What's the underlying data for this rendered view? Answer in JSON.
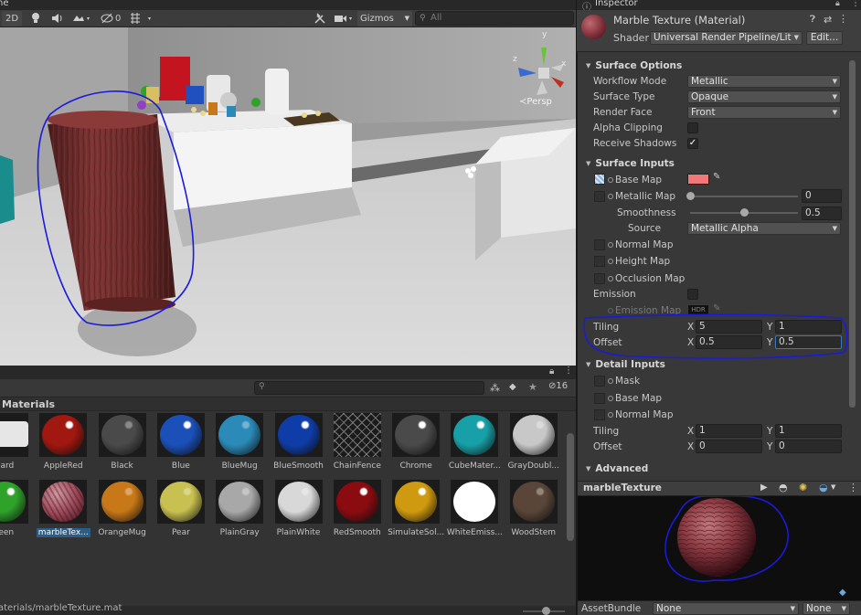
{
  "scene": {
    "tab_title": "ne",
    "toolbar": {
      "mode_2d": "2D",
      "effects_count": "0",
      "gizmos_label": "Gizmos",
      "search_placeholder": "All"
    },
    "persp_label": "Persp",
    "axis_labels": {
      "y": "y",
      "z": "z",
      "x": "x"
    }
  },
  "project": {
    "folder_title": "Materials",
    "item_count": "16",
    "materials": [
      {
        "name": "dard",
        "color": "#e6e6e6",
        "style": "flat"
      },
      {
        "name": "AppleRed",
        "color": "#a01810",
        "style": "glossy"
      },
      {
        "name": "Black",
        "color": "#4a4a4a",
        "style": "matte"
      },
      {
        "name": "Blue",
        "color": "#1b50b8",
        "style": "glossy"
      },
      {
        "name": "BlueMug",
        "color": "#2b8ab8",
        "style": "matte"
      },
      {
        "name": "BlueSmooth",
        "color": "#0f3da8",
        "style": "glossy"
      },
      {
        "name": "ChainFence",
        "color": "#1a1a1a",
        "style": "fence"
      },
      {
        "name": "Chrome",
        "color": "#4a4a4a",
        "style": "chrome"
      },
      {
        "name": "CubeMater...",
        "color": "#18a0a8",
        "style": "glossy"
      },
      {
        "name": "GrayDoubl...",
        "color": "#c8c8c8",
        "style": "matte"
      },
      {
        "name": "reen",
        "color": "#2fa22a",
        "style": "glossy"
      },
      {
        "name": "marbleTex...",
        "color": "#9c4a5a",
        "style": "marble",
        "selected": true
      },
      {
        "name": "OrangeMug",
        "color": "#c87818",
        "style": "matte"
      },
      {
        "name": "Pear",
        "color": "#c8c050",
        "style": "matte"
      },
      {
        "name": "PlainGray",
        "color": "#a8a8a8",
        "style": "matte"
      },
      {
        "name": "PlainWhite",
        "color": "#d8d8d8",
        "style": "matte"
      },
      {
        "name": "RedSmooth",
        "color": "#8a0c10",
        "style": "glossy"
      },
      {
        "name": "SimulateSol...",
        "color": "#d09a10",
        "style": "glossy"
      },
      {
        "name": "WhiteEmiss...",
        "color": "#ffffff",
        "style": "emissive"
      },
      {
        "name": "WoodStem",
        "color": "#5a4638",
        "style": "matte"
      }
    ],
    "path": "aterials/marbleTexture.mat"
  },
  "inspector": {
    "tab_title": "Inspector",
    "material_name": "Marble Texture (Material)",
    "shader_label": "Shader",
    "shader_value": "Universal Render Pipeline/Lit",
    "edit_button": "Edit...",
    "surface_options": {
      "title": "Surface Options",
      "workflow_label": "Workflow Mode",
      "workflow_value": "Metallic",
      "surface_type_label": "Surface Type",
      "surface_type_value": "Opaque",
      "render_face_label": "Render Face",
      "render_face_value": "Front",
      "alpha_clipping_label": "Alpha Clipping",
      "receive_shadows_label": "Receive Shadows"
    },
    "surface_inputs": {
      "title": "Surface Inputs",
      "base_map_label": "Base Map",
      "base_color": "#f07878",
      "metallic_map_label": "Metallic Map",
      "metallic_value": "0",
      "metallic_level": 0,
      "smoothness_label": "Smoothness",
      "smoothness_value": "0.5",
      "smoothness_level": 0.5,
      "source_label": "Source",
      "source_value": "Metallic Alpha",
      "normal_map_label": "Normal Map",
      "height_map_label": "Height Map",
      "occlusion_map_label": "Occlusion Map",
      "emission_label": "Emission",
      "emission_map_label": "Emission Map",
      "hdr_badge": "HDR",
      "tiling_label": "Tiling",
      "tiling_x": "5",
      "tiling_y": "1",
      "offset_label": "Offset",
      "offset_x": "0.5",
      "offset_y": "0.5"
    },
    "detail_inputs": {
      "title": "Detail Inputs",
      "mask_label": "Mask",
      "base_map_label": "Base Map",
      "normal_map_label": "Normal Map",
      "tiling_label": "Tiling",
      "tiling_x": "1",
      "tiling_y": "1",
      "offset_label": "Offset",
      "offset_x": "0",
      "offset_y": "0"
    },
    "advanced_title": "Advanced",
    "xy": {
      "x": "X",
      "y": "Y"
    },
    "preview_title": "marbleTexture",
    "assetbundle_label": "AssetBundle",
    "assetbundle_value": "None",
    "assetbundle_variant": "None"
  },
  "colors": {
    "annotation_blue": "#1a1adc",
    "selection_blue": "#2c5d87"
  }
}
